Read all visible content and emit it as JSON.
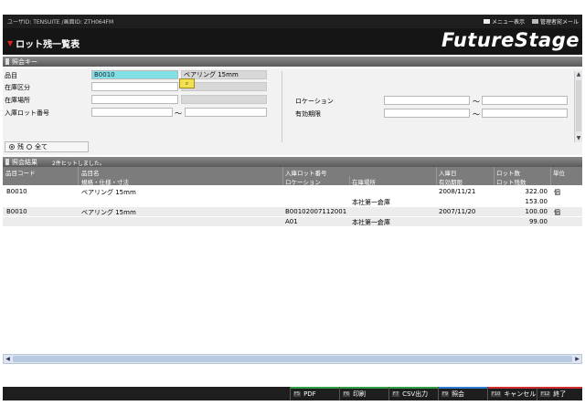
{
  "topbar": {
    "user_info": "ユーザID: TENSUITE /画面ID: ZTH064FM",
    "links": [
      {
        "label": "メニュー表示",
        "icon": "menu-square-icon"
      },
      {
        "label": "管理者宛メール",
        "icon": "mail-square-icon"
      }
    ]
  },
  "header": {
    "title": "ロット残一覧表",
    "logo": "FutureStage"
  },
  "search_section": {
    "title": "照会キー",
    "fields": {
      "item_label": "品目",
      "item_code": "B0010",
      "item_name": "ベアリング 15mm",
      "stock_type_label": "在庫区分",
      "location_label": "在庫場所",
      "lot_label": "入庫ロット番号",
      "rocation_label": "ロケーション",
      "expiry_label": "有効期限",
      "tilde": "～"
    },
    "radios": [
      {
        "label": "残",
        "checked": true
      },
      {
        "label": "全て",
        "checked": false
      }
    ]
  },
  "results": {
    "title": "照会結果",
    "message": "2件ヒットしました。",
    "header_row1": [
      "品目コード",
      "品目名",
      "入庫ロット番号",
      "入庫日",
      "ロット数",
      "単位"
    ],
    "header_row2": [
      "規格・仕様・寸法",
      "ロケーション",
      "在庫場所",
      "有効期限",
      "ロット残数"
    ],
    "rows": [
      {
        "code": "B0010",
        "name": "ベアリング 15mm",
        "lot": "",
        "date": "2008/11/21",
        "qty": "322.00",
        "unit": "個",
        "spec": "",
        "loc": "",
        "place": "本社第一倉庫",
        "expiry": "",
        "remain": "153.00"
      },
      {
        "code": "B0010",
        "name": "ベアリング 15mm",
        "lot": "B00102007112001",
        "date": "2007/11/20",
        "qty": "100.00",
        "unit": "個",
        "spec": "",
        "loc": "A01",
        "place": "本社第一倉庫",
        "expiry": "",
        "remain": "99.00"
      }
    ]
  },
  "function_keys": [
    {
      "key": "F5",
      "label": "PDF",
      "color": "#2f9e44"
    },
    {
      "key": "F6",
      "label": "印刷",
      "color": "#2f9e44"
    },
    {
      "key": "F7",
      "label": "CSV出力",
      "color": "#2f9e44"
    },
    {
      "key": "F9",
      "label": "照会",
      "color": "#2f7dd1"
    },
    {
      "key": "F10",
      "label": "キャンセル",
      "color": "#d12f2f"
    },
    {
      "key": "F12",
      "label": "終了",
      "color": "#d12f2f"
    }
  ]
}
